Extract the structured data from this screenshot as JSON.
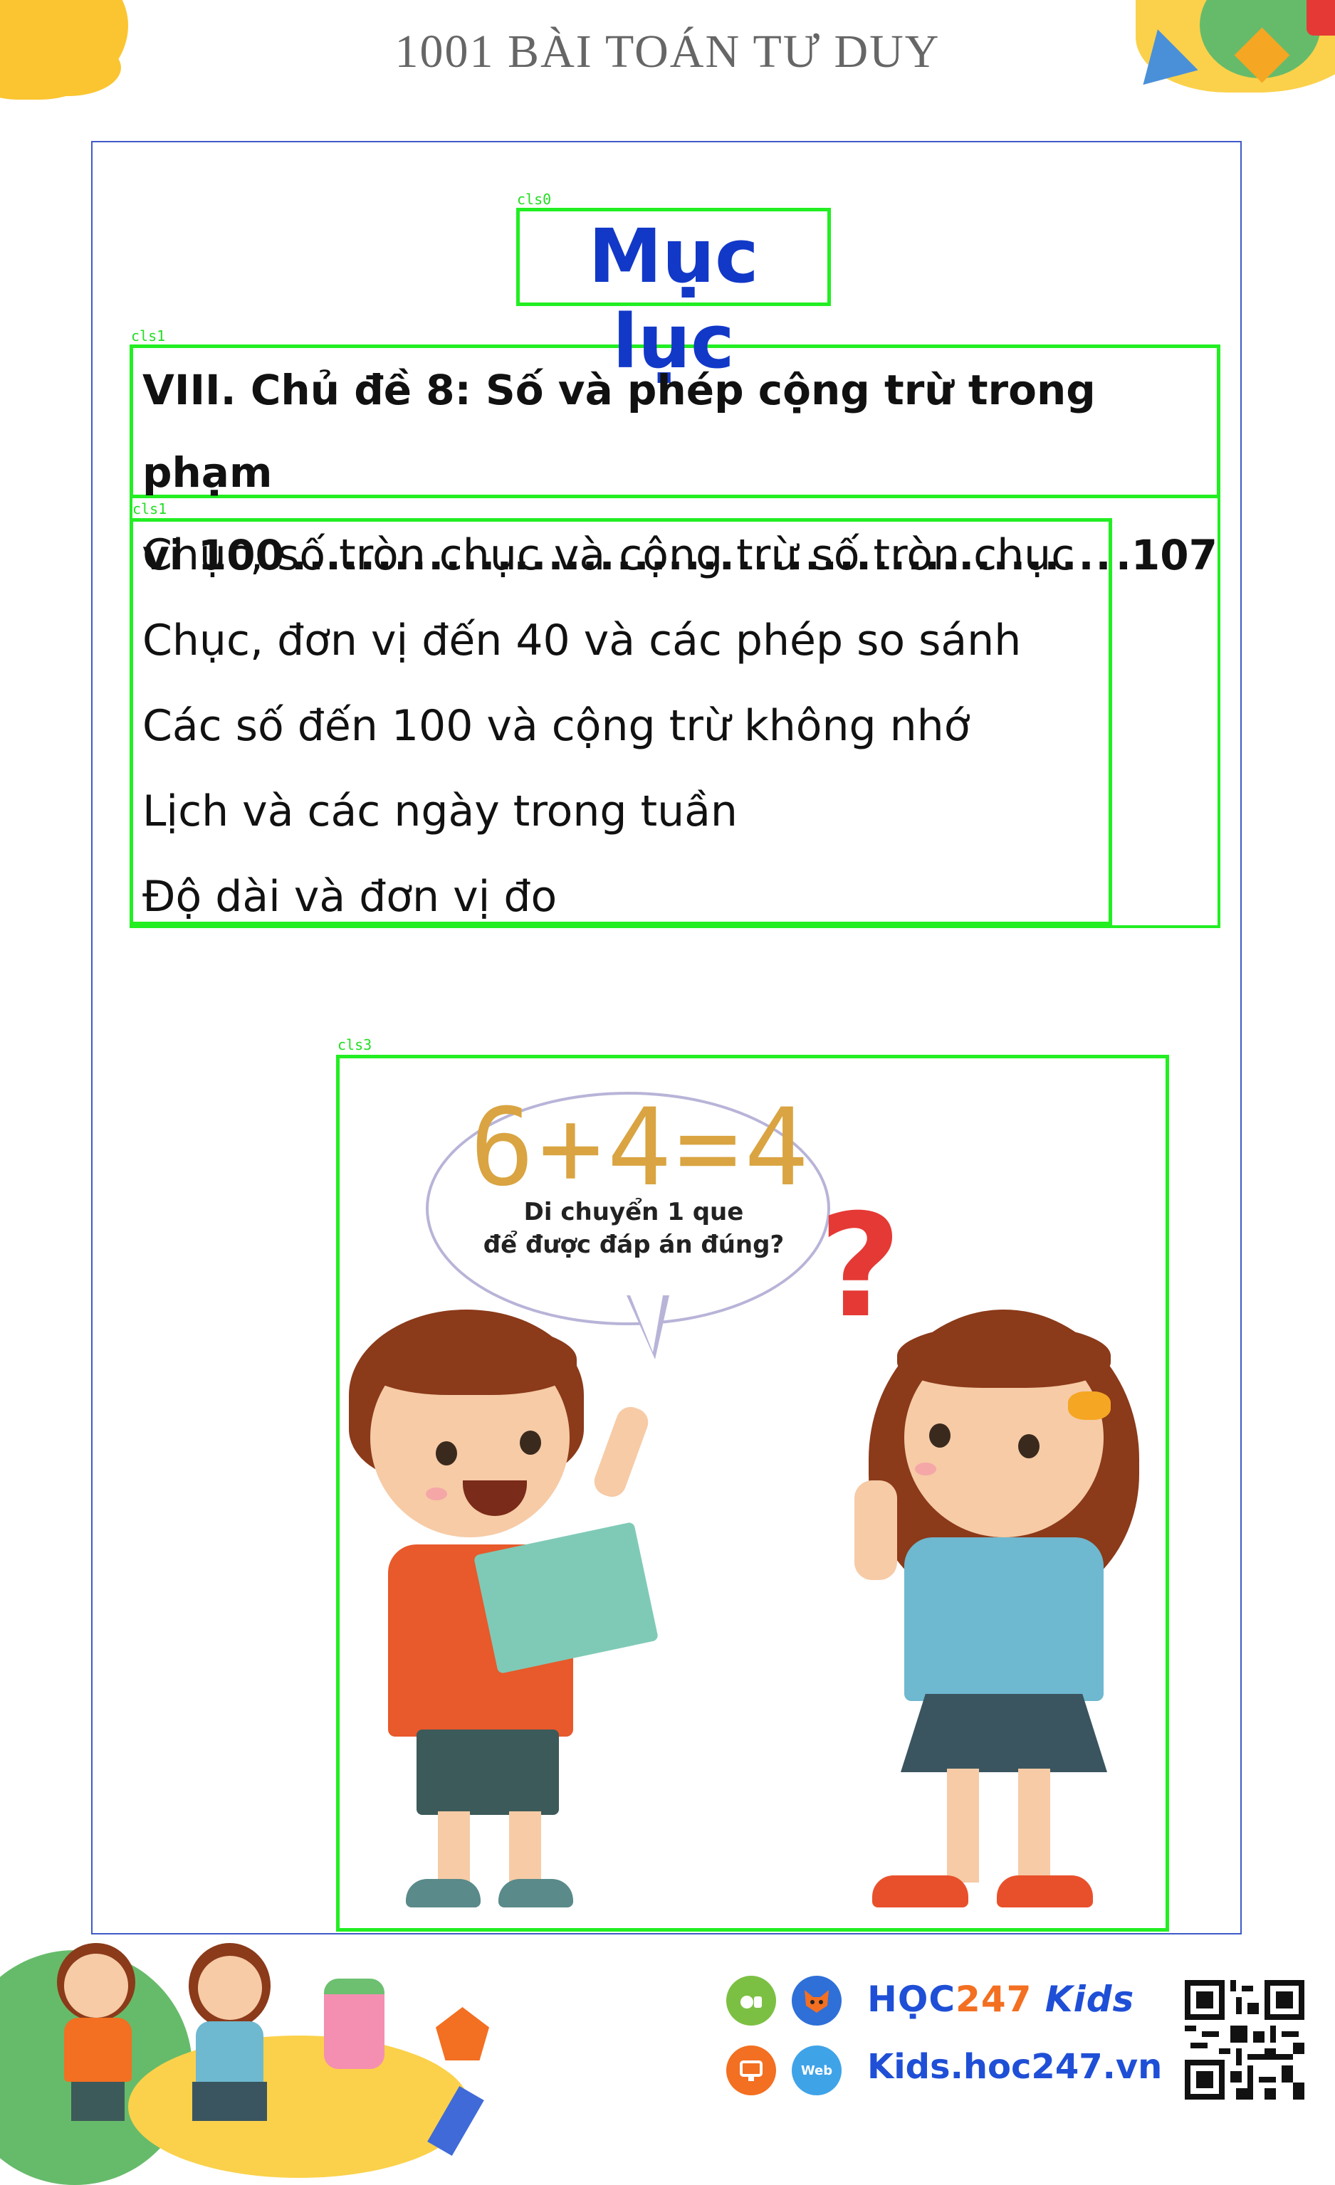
{
  "header": {
    "title": "1001 BÀI TOÁN TƯ DUY"
  },
  "labels": {
    "cls0": "cls0",
    "cls1a": "cls1",
    "cls1b": "cls1",
    "cls3": "cls3"
  },
  "toc": {
    "title": "Mục lục",
    "chapter": {
      "line1": "VIII. Chủ đề 8: Số và phép cộng trừ trong phạm",
      "line2": "vi 100",
      "page": ".107"
    },
    "items": [
      "Chục, số tròn chục và cộng trừ số tròn chục",
      "Chục, đơn vị đến 40 và các phép so sánh",
      "Các số đến 100 và cộng trừ không nhớ",
      "Lịch và các ngày trong tuần",
      "Độ dài và đơn vị đo"
    ]
  },
  "illustration": {
    "equation": "6+4=4",
    "bubble_line1": "Di chuyển 1 que",
    "bubble_line2": "để được đáp án đúng?",
    "question_mark": "?"
  },
  "footer": {
    "brand_prefix": "HỌC",
    "brand_number": "247",
    "brand_suffix": "Kids",
    "website": "Kids.hoc247.vn",
    "web_badge": "Web"
  },
  "colors": {
    "title_blue": "#1238c8",
    "frame_blue": "#3f5ac8",
    "detection_green": "#22ee22",
    "brand_blue": "#1f4fd6",
    "brand_orange": "#f36f21"
  }
}
